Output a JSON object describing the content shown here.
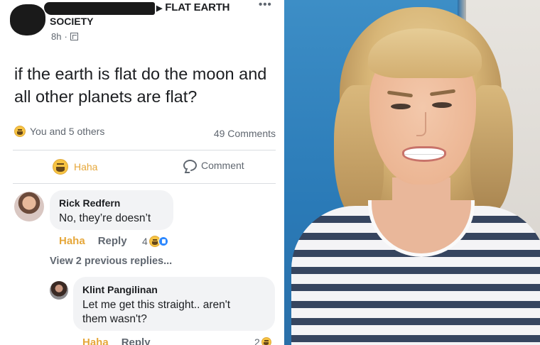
{
  "post": {
    "breadcrumb_group": "FLAT EARTH",
    "group_name_suffix": "SOCIETY",
    "time": "8h",
    "more_icon": "more-dots-icon",
    "text": "if the earth is flat do the moon and all other planets are flat?",
    "reactions_summary": "You and 5 others",
    "comments_count": "49 Comments",
    "actions": {
      "haha_label": "Haha",
      "comment_label": "Comment"
    }
  },
  "comments": [
    {
      "author": "Rick Redfern",
      "text": "No, they’re doesn’t",
      "haha_label": "Haha",
      "reply_label": "Reply",
      "reaction_count": "4"
    }
  ],
  "view_previous": "View 2 previous replies...",
  "replies": [
    {
      "author": "Klint Pangilinan",
      "text_line1": "Let me get this straight.. aren't",
      "text_line2": "them wasn't?",
      "haha_label": "Haha",
      "reply_label": "Reply",
      "reaction_count": "2"
    }
  ],
  "colors": {
    "haha": "#e6a73a",
    "text": "#1c1e21",
    "muted": "#606770",
    "like_blue": "#2d88ff"
  }
}
